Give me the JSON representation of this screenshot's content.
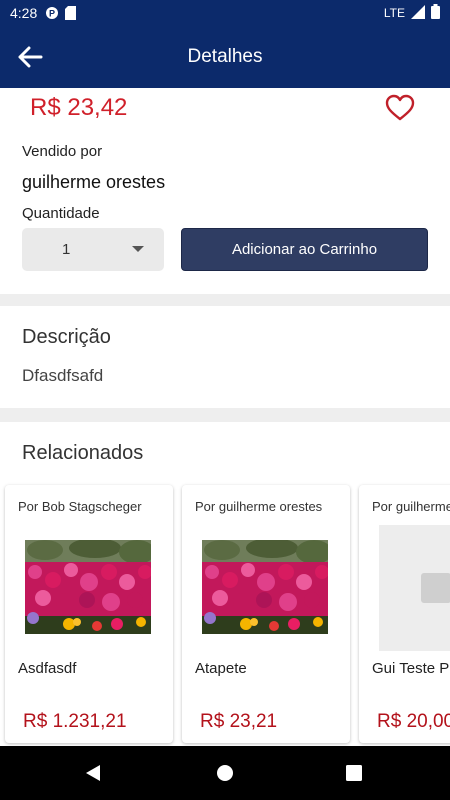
{
  "status_bar": {
    "time": "4:28",
    "network": "LTE",
    "icons": [
      "notification-icon",
      "sd-card-icon",
      "signal-icon",
      "battery-icon"
    ]
  },
  "app_bar": {
    "title": "Detalhes",
    "back_icon": "arrow-back-icon"
  },
  "product": {
    "price": "R$ 23,42",
    "favorite_icon": "heart-outline-icon",
    "sold_by_label": "Vendido por",
    "seller": "guilherme orestes",
    "quantity_label": "Quantidade",
    "quantity_value": "1",
    "add_to_cart_label": "Adicionar ao Carrinho"
  },
  "description": {
    "title": "Descrição",
    "text": "Dfasdfsafd"
  },
  "related": {
    "title": "Relacionados",
    "items": [
      {
        "seller": "Por Bob Stagscheger",
        "name": "Asdfasdf",
        "price": "R$ 1.231,21",
        "image": "flowers-photo"
      },
      {
        "seller": "Por guilherme orestes",
        "name": "Atapete",
        "price": "R$ 23,21",
        "image": "flowers-photo"
      },
      {
        "seller": "Por guilherme orestes",
        "name": "Gui Teste Produto",
        "price": "R$ 20,00",
        "image": "placeholder"
      }
    ]
  },
  "colors": {
    "primary": "#0c2a6b",
    "button": "#2f3d63",
    "price": "#d0202a"
  }
}
